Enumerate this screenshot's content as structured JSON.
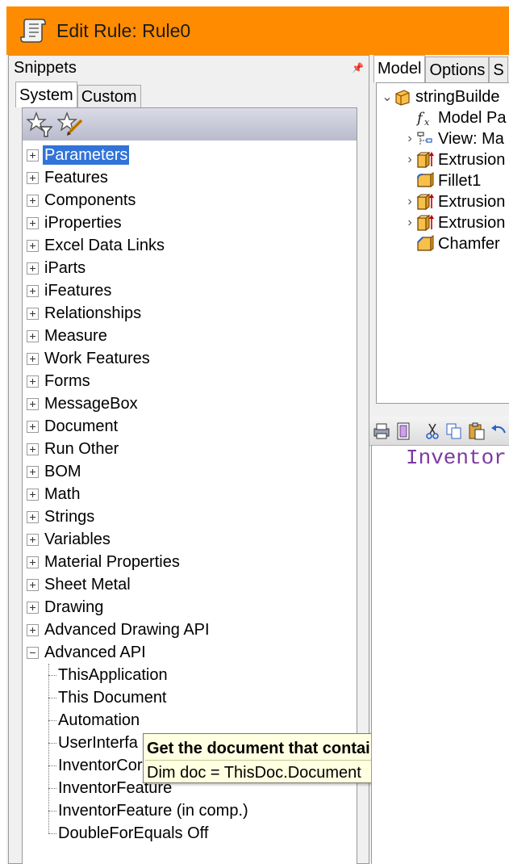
{
  "window": {
    "title": "Edit Rule: Rule0",
    "title_icon": "scroll-icon",
    "accent_color": "#ff8c00"
  },
  "snippets": {
    "header": "Snippets",
    "pin_icon": "pin-icon",
    "tabs": [
      "System",
      "Custom"
    ],
    "toolbar_icons": [
      "filter-star-icon",
      "edit-star-icon"
    ],
    "categories": [
      "Parameters",
      "Features",
      "Components",
      "iProperties",
      "Excel Data Links",
      "iParts",
      "iFeatures",
      "Relationships",
      "Measure",
      "Work Features",
      "Forms",
      "MessageBox",
      "Document",
      "Run Other",
      "BOM",
      "Math",
      "Strings",
      "Variables",
      "Material Properties",
      "Sheet Metal",
      "Drawing",
      "Advanced Drawing API"
    ],
    "selected_category": "Parameters",
    "expanded_category": "Advanced API",
    "expanded_children": [
      "ThisApplication",
      "This Document",
      "Automation",
      "UserInterfa",
      "InventorCor",
      "InventorFeature",
      "InventorFeature (in comp.)",
      "DoubleForEquals Off"
    ]
  },
  "tooltip": {
    "title": "Get the document that contains this rule",
    "code": "Dim doc = ThisDoc.Document"
  },
  "right_panel": {
    "tabs": [
      "Model",
      "Options",
      "S"
    ],
    "model_tree": [
      {
        "label": "stringBuilde",
        "icon": "part-icon",
        "chevron": "⌄"
      },
      {
        "label": "Model Pa",
        "icon": "fx-icon",
        "chevron": ""
      },
      {
        "label": "View: Ma",
        "icon": "view-icon",
        "chevron": "›"
      },
      {
        "label": "Extrusion",
        "icon": "extrusion-icon",
        "chevron": "›"
      },
      {
        "label": "Fillet1",
        "icon": "fillet-icon",
        "chevron": ""
      },
      {
        "label": "Extrusion",
        "icon": "extrusion-icon",
        "chevron": "›"
      },
      {
        "label": "Extrusion",
        "icon": "extrusion-icon",
        "chevron": "›"
      },
      {
        "label": "Chamfer",
        "icon": "chamfer-icon",
        "chevron": ""
      }
    ],
    "editor_toolbar_icons": [
      "print-icon",
      "print-preview-icon",
      "cut-icon",
      "copy-icon",
      "paste-icon",
      "undo-icon"
    ],
    "editor_text": "Inventor"
  }
}
